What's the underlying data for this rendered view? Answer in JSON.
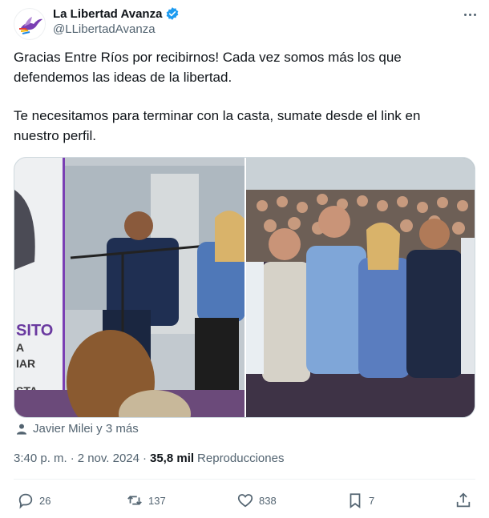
{
  "account": {
    "display_name": "La Libertad Avanza",
    "handle": "@LLibertadAvanza",
    "verified_icon": "verified-badge-icon",
    "brand_color": "#7a3fb3",
    "verified_color": "#1d9bf0"
  },
  "tweet": {
    "paragraph1": "Gracias Entre Ríos por recibirnos! Cada vez somos más los que defendemos las ideas de la libertad.",
    "paragraph2": "Te necesitamos para terminar con la casta, sumate desde el link en nuestro perfil."
  },
  "media": {
    "banner_lines": [
      "SITO",
      "A",
      "IAR",
      "STA"
    ]
  },
  "tagged": {
    "text": "Javier Milei y 3 más"
  },
  "meta": {
    "time": "3:40 p. m.",
    "separator": "·",
    "date": "2 nov. 2024",
    "views_count": "35,8 mil",
    "views_label": "Reproducciones"
  },
  "actions": {
    "replies": "26",
    "reposts": "137",
    "likes": "838",
    "bookmarks": "7"
  }
}
